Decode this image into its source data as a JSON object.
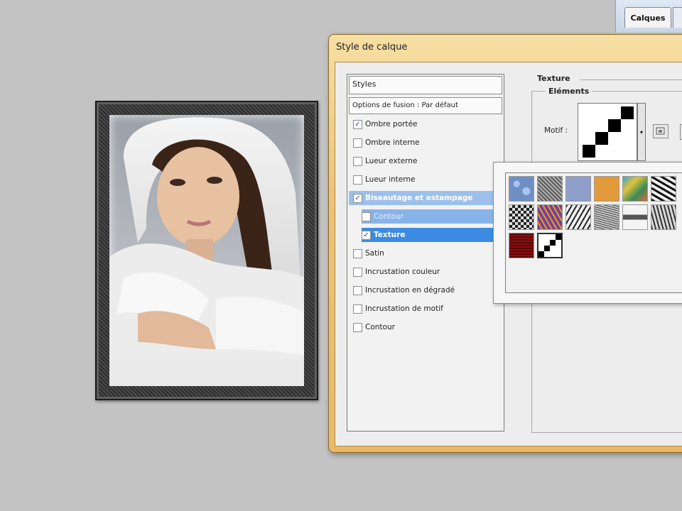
{
  "layers_panel": {
    "tab_label": "Calques"
  },
  "dialog": {
    "title": "Style de calque",
    "styles_header": "Styles",
    "blending_options": "Options de fusion : Par défaut",
    "items": [
      {
        "label": "Ombre portée",
        "checked": true
      },
      {
        "label": "Ombre interne",
        "checked": false
      },
      {
        "label": "Lueur externe",
        "checked": false
      },
      {
        "label": "Lueur interne",
        "checked": false
      },
      {
        "label": "Biseautage et estampage",
        "checked": true
      },
      {
        "label": "Contour",
        "checked": false
      },
      {
        "label": "Texture",
        "checked": true
      },
      {
        "label": "Satin",
        "checked": false
      },
      {
        "label": "Incrustation couleur",
        "checked": false
      },
      {
        "label": "Incrustation en dégradé",
        "checked": false
      },
      {
        "label": "Incrustation de motif",
        "checked": false
      },
      {
        "label": "Contour",
        "checked": false
      }
    ],
    "texture_group": "Texture",
    "elements_group": "Eléments",
    "pattern_label": "Motif :"
  },
  "pattern_picker": {
    "patterns": [
      {
        "name": "blue-bubbles",
        "color": "#6f8fc4"
      },
      {
        "name": "gray-noise",
        "color": "#8a8a8a"
      },
      {
        "name": "lavender",
        "color": "#8f9fc9"
      },
      {
        "name": "orange",
        "color": "#e29a3a"
      },
      {
        "name": "tie-dye",
        "color": "#d8b040"
      },
      {
        "name": "bw-scatter",
        "color": "#4c4c4c"
      },
      {
        "name": "checker-noise",
        "color": "#555555"
      },
      {
        "name": "color-noise",
        "color": "#8060a0"
      },
      {
        "name": "bw-splatter",
        "color": "#707070"
      },
      {
        "name": "gray-grain",
        "color": "#7a7a7a"
      },
      {
        "name": "stripes",
        "color": "#909090"
      },
      {
        "name": "mixed-noise",
        "color": "#6a6a6a"
      },
      {
        "name": "dark-red",
        "color": "#7a0d0d"
      },
      {
        "name": "diagonal-steps",
        "color": "#000000",
        "selected": true
      }
    ]
  }
}
